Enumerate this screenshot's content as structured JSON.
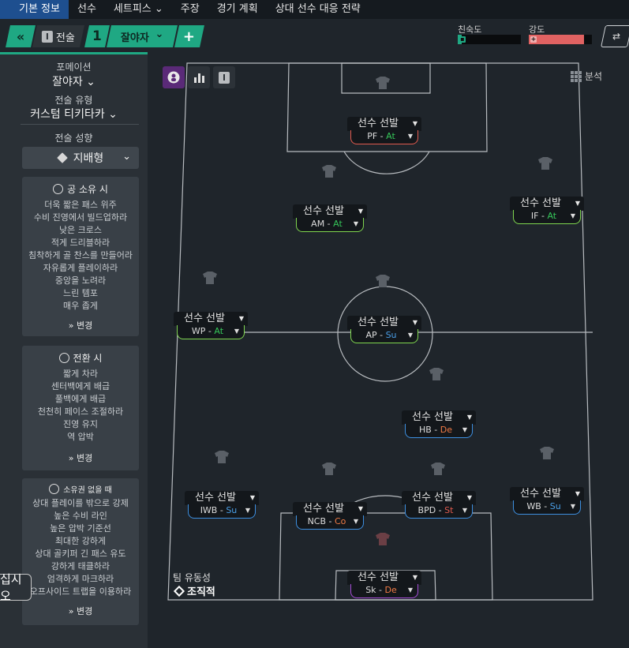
{
  "topnav": {
    "tabs": [
      "기본 정보",
      "선수",
      "세트피스 ⌄",
      "주장",
      "경기 계획",
      "상대 선수 대응 전략"
    ]
  },
  "toolbar": {
    "back_icon": "«",
    "tactic_label": "전술",
    "tactic_number": "1",
    "formation_name": "잘야자",
    "formation_chevron": "⌄",
    "add_icon": "+",
    "familiarity_label": "친숙도",
    "familiarity_level": 0.06,
    "intensity_label": "강도",
    "intensity_level": 0.87,
    "swap_icon": "⇄"
  },
  "colors": {
    "accent": "#1fa883",
    "familiarity": "#1fa883",
    "intensity": "#e06262",
    "attack": "#35c759",
    "support": "#4a9fe8",
    "defend": "#f07b45",
    "role_red": "#e05a4e",
    "role_green": "#7fd64f",
    "role_blue": "#3d8fe0",
    "role_purple": "#a54bd6"
  },
  "sidebar": {
    "formation_label": "포메이션",
    "formation_value": "잘야자",
    "tactic_type_label": "전술 유형",
    "tactic_type_value": "커스텀 티키타카",
    "style_label": "전술 성향",
    "style_value": "지배형",
    "in_possession": {
      "title": "공 소유 시",
      "lines": [
        "더욱 짧은 패스 위주",
        "수비 진영에서 빌드업하라",
        "낮은 크로스",
        "적게 드리블하라",
        "침착하게 골 찬스를 만들어라",
        "자유롭게 플레이하라",
        "중앙을 노려라",
        "느린 템포",
        "매우 좁게"
      ],
      "change": "변경"
    },
    "transition": {
      "title": "전환 시",
      "lines": [
        "짧게 차라",
        "센터백에게 배급",
        "풀백에게 배급",
        "천천히 페이스 조절하라",
        "진영 유지",
        "역 압박"
      ],
      "change": "변경"
    },
    "out_of_possession": {
      "title": "소유권 없을 때",
      "lines": [
        "상대 플레이를 밖으로 강제",
        "높은 수비 라인",
        "높은 압박 기준선",
        "최대한 강하게",
        "상대 골키퍼 긴 패스 유도",
        "강하게 태클하라",
        "엄격하게 마크하라",
        "오프사이드 트랩을 이용하라"
      ],
      "change": "변경"
    },
    "change_icon": "»",
    "tooltip_fragment": "십시오"
  },
  "pitch": {
    "analysis_label": "분석",
    "fluidity_label": "팀 유동성",
    "fluidity_value": "조직적",
    "players": [
      {
        "name": "선수 선발",
        "role": "PF",
        "duty": "At",
        "border": "#e05a4e"
      },
      {
        "name": "선수 선발",
        "role": "AM",
        "duty": "At",
        "border": "#7fd64f"
      },
      {
        "name": "선수 선발",
        "role": "IF",
        "duty": "At",
        "border": "#7fd64f"
      },
      {
        "name": "선수 선발",
        "role": "WP",
        "duty": "At",
        "border": "#7fd64f"
      },
      {
        "name": "선수 선발",
        "role": "AP",
        "duty": "Su",
        "border": "#7fd64f"
      },
      {
        "name": "선수 선발",
        "role": "HB",
        "duty": "De",
        "border": "#3d8fe0"
      },
      {
        "name": "선수 선발",
        "role": "IWB",
        "duty": "Su",
        "border": "#3d8fe0"
      },
      {
        "name": "선수 선발",
        "role": "NCB",
        "duty": "Co",
        "border": "#3d8fe0"
      },
      {
        "name": "선수 선발",
        "role": "BPD",
        "duty": "St",
        "border": "#3d8fe0"
      },
      {
        "name": "선수 선발",
        "role": "WB",
        "duty": "Su",
        "border": "#3d8fe0"
      },
      {
        "name": "선수 선발",
        "role": "Sk",
        "duty": "De",
        "border": "#a54bd6"
      }
    ]
  }
}
